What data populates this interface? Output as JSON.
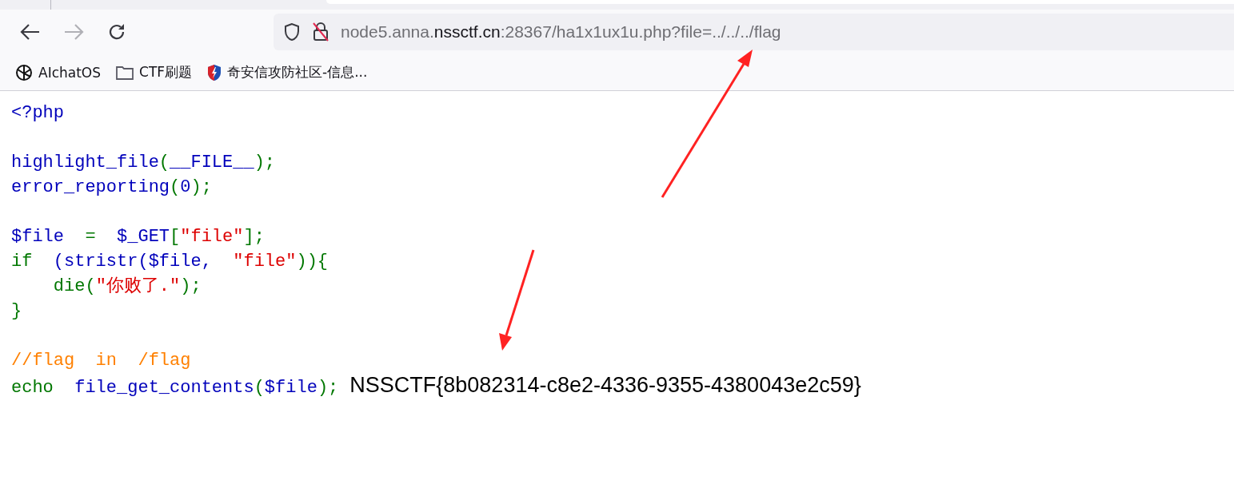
{
  "toolbar": {
    "address": {
      "prefix": "node5.anna.",
      "domain": "nssctf.cn",
      "suffix": ":28367/ha1x1ux1u.php?file=../../../flag"
    }
  },
  "bookmarks": [
    {
      "kind": "chat",
      "label": "AIchatOS"
    },
    {
      "kind": "folder",
      "label": "CTF刷题"
    },
    {
      "kind": "shield",
      "label": "奇安信攻防社区-信息..."
    }
  ],
  "code_blocks": [
    [
      [
        {
          "kind": "default",
          "text": "<?php"
        }
      ]
    ],
    [
      [
        {
          "kind": "default",
          "text": "highlight_file"
        },
        {
          "kind": "keyword",
          "text": "("
        },
        {
          "kind": "default",
          "text": "__FILE__"
        },
        {
          "kind": "keyword",
          "text": ");"
        }
      ],
      [
        {
          "kind": "default",
          "text": "error_reporting"
        },
        {
          "kind": "keyword",
          "text": "("
        },
        {
          "kind": "default",
          "text": "0"
        },
        {
          "kind": "keyword",
          "text": ");"
        }
      ]
    ],
    [
      [
        {
          "kind": "default",
          "text": "$file"
        },
        {
          "kind": "keyword",
          "text": "  =  "
        },
        {
          "kind": "default",
          "text": "$_GET"
        },
        {
          "kind": "keyword",
          "text": "["
        },
        {
          "kind": "string",
          "text": "\"file\""
        },
        {
          "kind": "keyword",
          "text": "];"
        }
      ],
      [
        {
          "kind": "keyword",
          "text": "if  "
        },
        {
          "kind": "default",
          "text": "(stristr($file,  "
        },
        {
          "kind": "string",
          "text": "\"file\""
        },
        {
          "kind": "keyword",
          "text": ")){"
        }
      ],
      [
        {
          "kind": "keyword",
          "text": "    die("
        },
        {
          "kind": "string",
          "text": "\"你败了.\""
        },
        {
          "kind": "keyword",
          "text": ");"
        }
      ],
      [
        {
          "kind": "keyword",
          "text": "}"
        }
      ]
    ],
    [
      [
        {
          "kind": "comment",
          "text": "//flag  in  /flag"
        }
      ],
      [
        {
          "kind": "keyword",
          "text": "echo  "
        },
        {
          "kind": "default",
          "text": "file_get_contents"
        },
        {
          "kind": "keyword",
          "text": "("
        },
        {
          "kind": "default",
          "text": "$file"
        },
        {
          "kind": "keyword",
          "text": ");"
        }
      ]
    ]
  ],
  "output": "NSSCTF{8b082314-c8e2-4336-9355-4380043e2c59}"
}
